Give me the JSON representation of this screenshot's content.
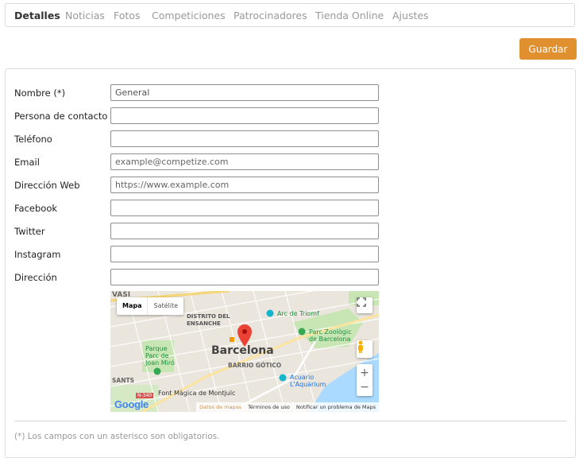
{
  "tabs": [
    {
      "label": "Detalles",
      "active": true
    },
    {
      "label": "Noticias",
      "active": false
    },
    {
      "label": "Fotos",
      "active": false
    },
    {
      "label": "Competiciones",
      "active": false
    },
    {
      "label": "Patrocinadores",
      "active": false
    },
    {
      "label": "Tienda Online",
      "active": false
    },
    {
      "label": "Ajustes",
      "active": false
    }
  ],
  "actions": {
    "save_label": "Guardar"
  },
  "form": {
    "name": {
      "label": "Nombre (*)",
      "value": "General"
    },
    "contact": {
      "label": "Persona de contacto",
      "value": ""
    },
    "phone": {
      "label": "Teléfono",
      "value": ""
    },
    "email": {
      "label": "Email",
      "placeholder": "example@competize.com"
    },
    "web": {
      "label": "Dirección Web",
      "placeholder": "https://www.example.com"
    },
    "facebook": {
      "label": "Facebook",
      "value": ""
    },
    "twitter": {
      "label": "Twitter",
      "value": ""
    },
    "instagram": {
      "label": "Instagram",
      "value": ""
    },
    "address": {
      "label": "Dirección",
      "value": ""
    }
  },
  "map": {
    "city_label": "Barcelona",
    "map_type": {
      "map": "Mapa",
      "satellite": "Satélite"
    },
    "places": {
      "eixample": "DISTRITO DEL ENSANCHE",
      "arc": "Arc de Triomf",
      "zoo": "Parc Zoològic de Barcelona",
      "parc": "Parque Parc de Joan Miró",
      "gotic": "BARRIO GÓTICO",
      "aquarium": "Acuario L'Aquàrium",
      "font": "Font Màgica de Montjuïc",
      "road": "N-340",
      "top_left": "VASI",
      "bottom_left": "SANTS"
    },
    "footer": {
      "data": "Datos de mapas",
      "terms": "Términos de uso",
      "report": "Notificar un problema de Maps"
    },
    "logo": "Google",
    "zoom_in": "+",
    "zoom_out": "−"
  },
  "footnote": "(*) Los campos con un asterisco son obligatorios.",
  "colors": {
    "accent": "#e0902f",
    "pin": "#ea4335"
  }
}
